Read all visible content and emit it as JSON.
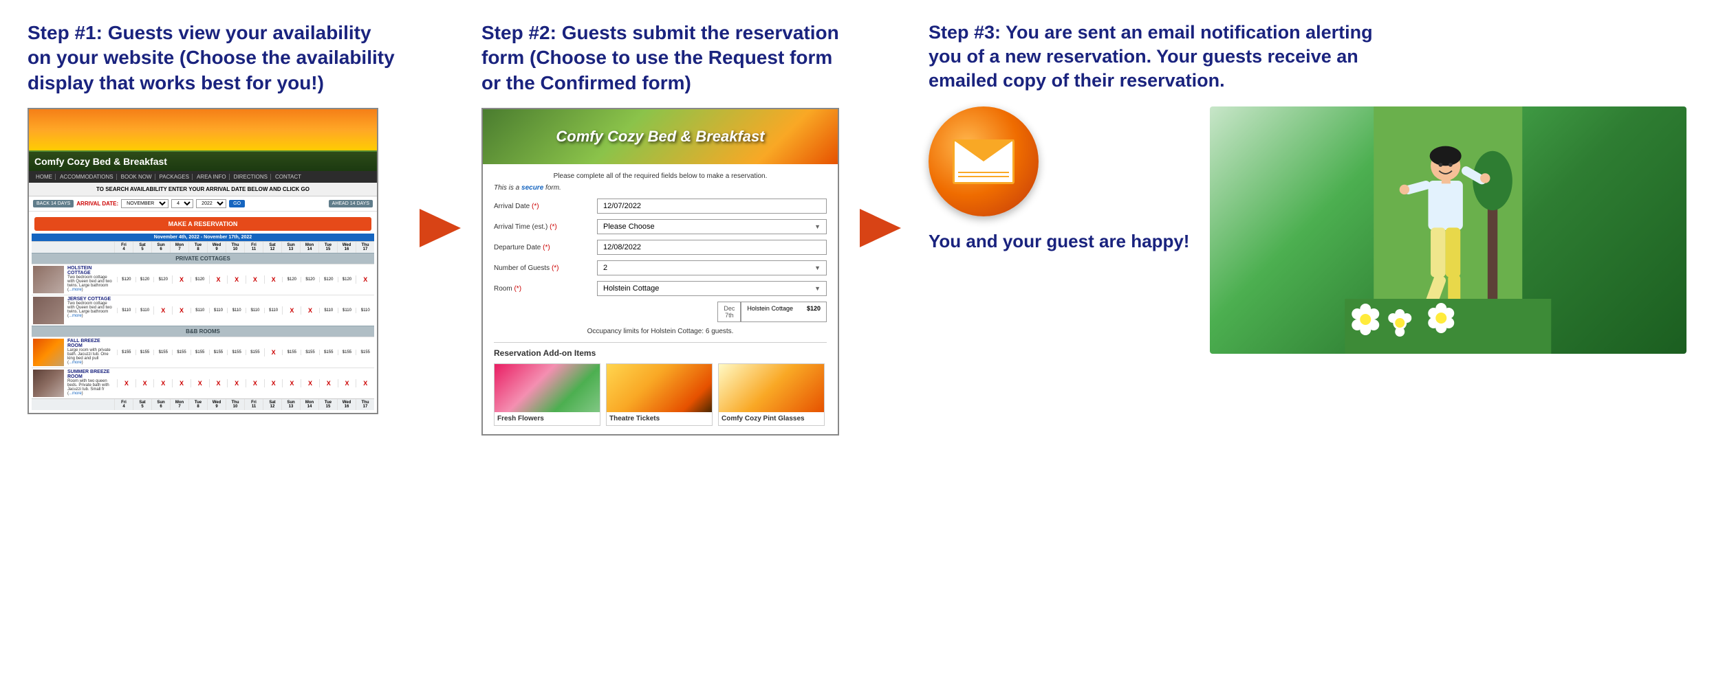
{
  "col1": {
    "heading": "Step #1: Guests view your availability on your website (Choose the availability display that works best for you!)",
    "website": {
      "title": "Comfy Cozy Bed & Breakfast",
      "nav": [
        "HOME",
        "ACCOMMODATIONS",
        "BOOK NOW",
        "PACKAGES",
        "AREA INFO",
        "DIRECTIONS",
        "CONTACT"
      ],
      "search_label": "TO SEARCH AVAILABILITY ENTER YOUR ARRIVAL DATE BELOW AND CLICK GO",
      "back_btn": "BACK 14 DAYS",
      "arrival_label": "ARRIVAL DATE:",
      "month_val": "NOVEMBER",
      "day_val": "4",
      "year_val": "2022",
      "go_btn": "GO",
      "ahead_btn": "AHEAD 14 DAYS",
      "make_reservation": "MAKE A RESERVATION",
      "date_range": "November 4th, 2022 - November 17th, 2022",
      "private_cottages": "PRIVATE COTTAGES",
      "bb_rooms": "B&B ROOMS",
      "rooms": [
        {
          "name": "HOLSTEIN COTTAGE",
          "desc": "Two bedroom cottage with Queen bed and two twins. Large bathroom (...more)",
          "prices": [
            "$120",
            "$120",
            "$120",
            "X",
            "$120",
            "X",
            "X",
            "X",
            "X",
            "$120",
            "$120",
            "$120",
            "$120",
            "X"
          ]
        },
        {
          "name": "JERSEY COTTAGE",
          "desc": "Two bedroom cottage with Queen bed and two twins. Large bathroom (...more)",
          "prices": [
            "$110",
            "$110",
            "X",
            "X",
            "$110",
            "$110",
            "$110",
            "$110",
            "$110",
            "X",
            "X",
            "$110",
            "$110"
          ]
        },
        {
          "name": "FALL BREEZE ROOM",
          "desc": "Large room with private bath. Jacuzzi tub. One king bed and pull (...more)",
          "prices": [
            "$155",
            "$155",
            "$155",
            "$155",
            "$155",
            "$155",
            "$155",
            "$155",
            "X",
            "$155",
            "$155",
            "$155",
            "$155"
          ]
        },
        {
          "name": "SUMMER BREEZE ROOM",
          "desc": "Room with two queen beds. Private bath with Jacuzzi tub. Small fr (...more)",
          "prices": [
            "X",
            "X",
            "X",
            "X",
            "X",
            "X",
            "X",
            "X",
            "X",
            "X",
            "X",
            "X",
            "X"
          ]
        }
      ],
      "date_cols": [
        "Fri\n4",
        "Sat\n5",
        "Sun\n6",
        "Mon\n7",
        "Tue\n8",
        "Wed\n9",
        "Thu\n10",
        "Fri\n11",
        "Sat\n12",
        "Sun\n13",
        "Mon\n14",
        "Tue\n15",
        "Wed\n16",
        "Thu\n17"
      ]
    }
  },
  "col2": {
    "heading": "Step #2: Guests submit the reservation form (Choose to use the Request form or the Confirmed form)",
    "form": {
      "hero_title": "Comfy Cozy Bed & Breakfast",
      "intro": "Please complete all of the required fields below to make a reservation.",
      "secure_text": "This is a secure form.",
      "arrival_date_label": "Arrival Date",
      "arrival_date_req": "(*)",
      "arrival_date_val": "12/07/2022",
      "arrival_time_label": "Arrival Time (est.)",
      "arrival_time_req": "(*)",
      "arrival_time_val": "Please Choose",
      "departure_date_label": "Departure Date",
      "departure_date_req": "(*)",
      "departure_date_val": "12/08/2022",
      "guests_label": "Number of Guests",
      "guests_req": "(*)",
      "guests_val": "2",
      "room_label": "Room",
      "room_req": "(*)",
      "room_val": "Holstein Cottage",
      "calendar_date": "Dec\n7th",
      "calendar_room": "Holstein Cottage",
      "calendar_price": "$120",
      "occupancy_text": "Occupancy limits for Holstein Cottage: 6 guests.",
      "addon_title": "Reservation Add-on Items",
      "addons": [
        {
          "label": "Fresh Flowers"
        },
        {
          "label": "Theatre Tickets"
        },
        {
          "label": "Comfy Cozy Pint Glasses"
        }
      ]
    }
  },
  "col3": {
    "heading": "Step #3: You are sent an email notification alerting you of a new reservation. Your guests receive an emailed copy of their reservation.",
    "happy_text": "You and your guest are happy!"
  },
  "arrow": "→"
}
